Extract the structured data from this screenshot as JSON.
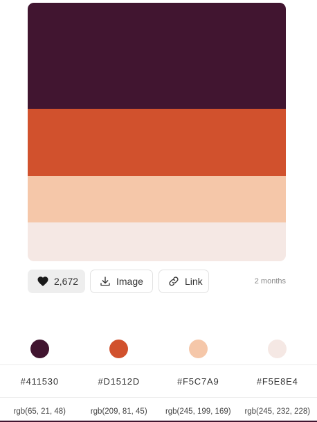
{
  "palette": {
    "colors": [
      "#411530",
      "#D1512D",
      "#F5C7A9",
      "#F5E8E4"
    ]
  },
  "actions": {
    "likes": "2,672",
    "image_label": "Image",
    "link_label": "Link",
    "age": "2 months"
  },
  "colors": [
    {
      "hex": "#411530",
      "rgb": "rgb(65, 21, 48)"
    },
    {
      "hex": "#D1512D",
      "rgb": "rgb(209, 81, 45)"
    },
    {
      "hex": "#F5C7A9",
      "rgb": "rgb(245, 199, 169)"
    },
    {
      "hex": "#F5E8E4",
      "rgb": "rgb(245, 232, 228)"
    }
  ]
}
